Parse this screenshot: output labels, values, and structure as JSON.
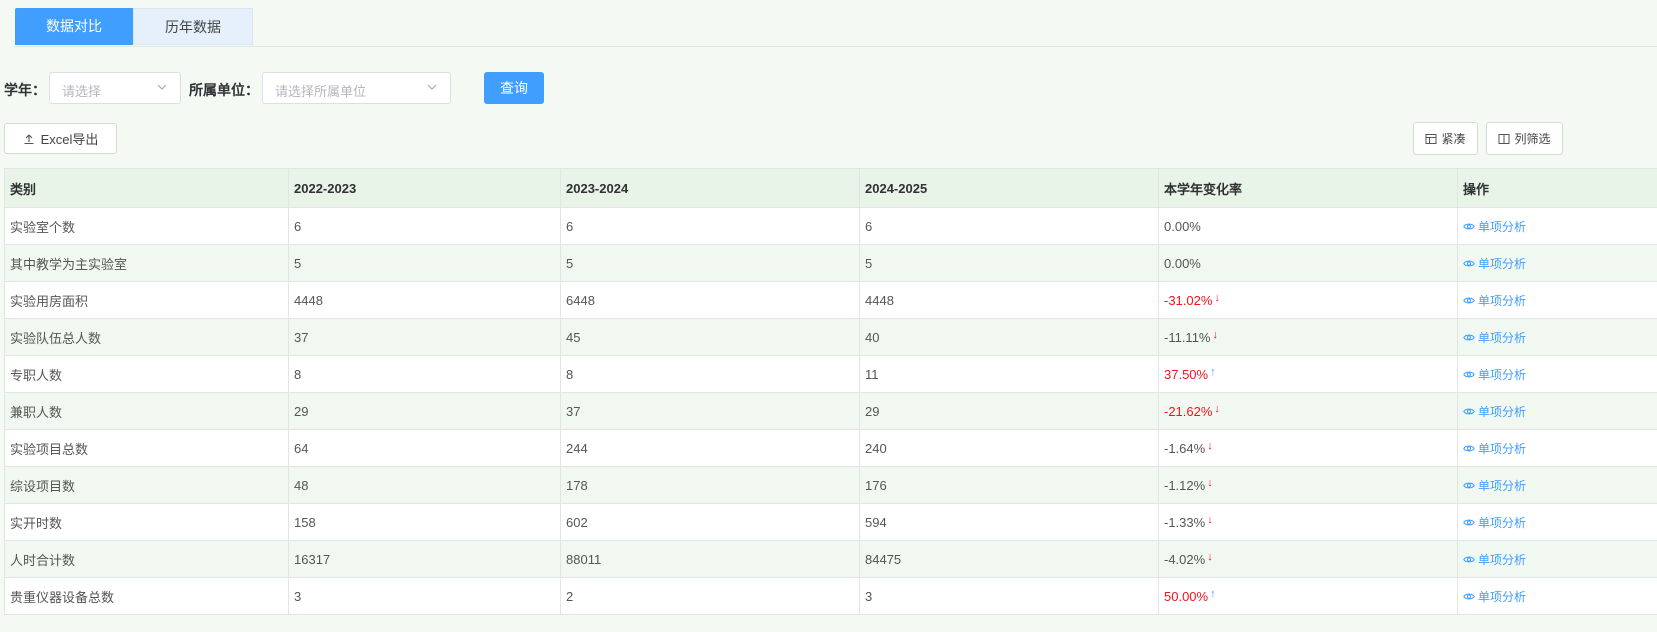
{
  "tabs": [
    {
      "label": "数据对比",
      "active": true
    },
    {
      "label": "历年数据",
      "active": false
    }
  ],
  "filters": {
    "year_label": "学年：",
    "year_placeholder": "请选择",
    "unit_label": "所属单位：",
    "unit_placeholder": "请选择所属单位",
    "query_label": "查询"
  },
  "toolbar": {
    "export_label": "Excel导出",
    "compact_label": "紧凑",
    "columns_label": "列筛选"
  },
  "table": {
    "headers": [
      "类别",
      "2022-2023",
      "2023-2024",
      "2024-2025",
      "本学年变化率",
      "操作"
    ],
    "action_label": "单项分析",
    "rows": [
      {
        "category": "实验室个数",
        "y1": "6",
        "y2": "6",
        "y3": "6",
        "rate": "0.00%",
        "trend": "none",
        "highlight": false
      },
      {
        "category": "其中教学为主实验室",
        "y1": "5",
        "y2": "5",
        "y3": "5",
        "rate": "0.00%",
        "trend": "none",
        "highlight": false
      },
      {
        "category": "实验用房面积",
        "y1": "4448",
        "y2": "6448",
        "y3": "4448",
        "rate": "-31.02%",
        "trend": "down",
        "highlight": true
      },
      {
        "category": "实验队伍总人数",
        "y1": "37",
        "y2": "45",
        "y3": "40",
        "rate": "-11.11%",
        "trend": "down",
        "highlight": false
      },
      {
        "category": "专职人数",
        "y1": "8",
        "y2": "8",
        "y3": "11",
        "rate": "37.50%",
        "trend": "up",
        "highlight": true
      },
      {
        "category": "兼职人数",
        "y1": "29",
        "y2": "37",
        "y3": "29",
        "rate": "-21.62%",
        "trend": "down",
        "highlight": true
      },
      {
        "category": "实验项目总数",
        "y1": "64",
        "y2": "244",
        "y3": "240",
        "rate": "-1.64%",
        "trend": "down",
        "highlight": false
      },
      {
        "category": "综设项目数",
        "y1": "48",
        "y2": "178",
        "y3": "176",
        "rate": "-1.12%",
        "trend": "down",
        "highlight": false
      },
      {
        "category": "实开时数",
        "y1": "158",
        "y2": "602",
        "y3": "594",
        "rate": "-1.33%",
        "trend": "down",
        "highlight": false
      },
      {
        "category": "人时合计数",
        "y1": "16317",
        "y2": "88011",
        "y3": "84475",
        "rate": "-4.02%",
        "trend": "down",
        "highlight": false
      },
      {
        "category": "贵重仪器设备总数",
        "y1": "3",
        "y2": "2",
        "y3": "3",
        "rate": "50.00%",
        "trend": "up",
        "highlight": true
      }
    ]
  },
  "colors": {
    "primary": "#409eff",
    "negative": "#f5141b",
    "header_bg": "#e8f4e8",
    "stripe_bg": "#f1f8f1"
  }
}
